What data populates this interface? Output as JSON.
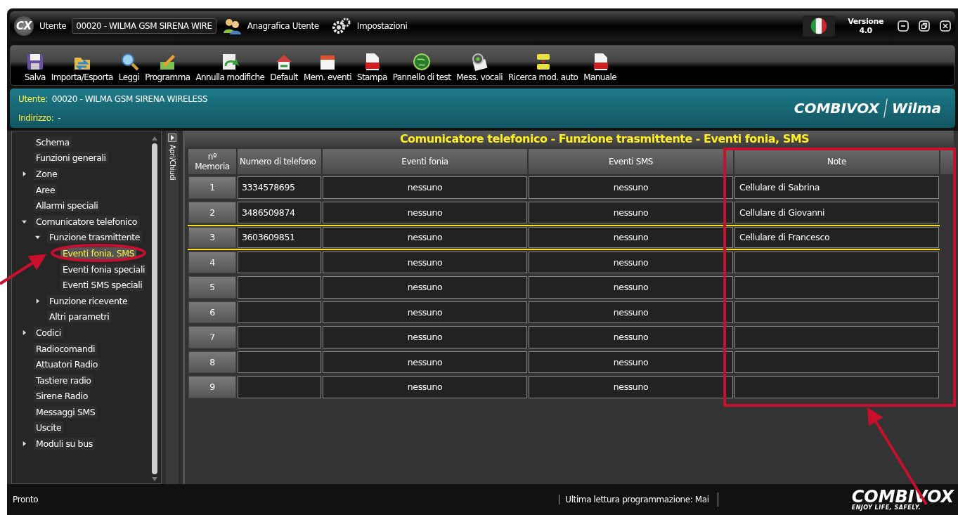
{
  "title_bar": {
    "logo": "CX",
    "utente_label": "Utente",
    "utente_value": "00020 - WILMA GSM SIRENA WIRE",
    "links": [
      {
        "kind": "users",
        "label": "Anagrafica Utente"
      },
      {
        "kind": "gears",
        "label": "Impostazioni"
      }
    ],
    "version_label": "Versione",
    "version_value": "4.0"
  },
  "toolbar": [
    {
      "kind": "floppy",
      "label": "Salva"
    },
    {
      "kind": "import",
      "label": "Importa/Esporta"
    },
    {
      "kind": "magnifier",
      "label": "Leggi"
    },
    {
      "kind": "pencil",
      "label": "Programma"
    },
    {
      "kind": "undo",
      "label": "Annulla modifiche"
    },
    {
      "kind": "house",
      "label": "Default"
    },
    {
      "kind": "calendar",
      "label": "Mem. eventi"
    },
    {
      "kind": "pdf",
      "label": "Stampa"
    },
    {
      "kind": "globe",
      "label": "Pannello di test"
    },
    {
      "kind": "headset",
      "label": "Mess. vocali"
    },
    {
      "kind": "plug",
      "label": "Ricerca mod. auto"
    },
    {
      "kind": "pdf",
      "label": "Manuale"
    }
  ],
  "header": {
    "utente_label": "Utente:",
    "utente_value": "00020  -  WILMA GSM SIRENA WIRELESS",
    "indirizzo_label": "Indirizzo:",
    "indirizzo_value": "-",
    "brand": "COMBIVOX",
    "brand_sub": "Wilma"
  },
  "sidebar": {
    "toggle": "Apri/Chiudi",
    "items": [
      {
        "kind": "leaf",
        "label": "Schema",
        "selected": false
      },
      {
        "kind": "leaf",
        "label": "Funzioni generali",
        "selected": false
      },
      {
        "kind": "folder",
        "label": "Zone",
        "expanded": false,
        "selected": false
      },
      {
        "kind": "leaf",
        "label": "Aree",
        "selected": false
      },
      {
        "kind": "leaf",
        "label": "Allarmi speciali",
        "selected": false
      },
      {
        "kind": "folder",
        "label": "Comunicatore telefonico",
        "expanded": true,
        "selected": false,
        "children": [
          {
            "kind": "folder",
            "label": "Funzione trasmittente",
            "expanded": true,
            "selected": false,
            "children": [
              {
                "kind": "leaf",
                "label": "Eventi fonia, SMS",
                "selected": true
              },
              {
                "kind": "leaf",
                "label": "Eventi fonia speciali",
                "selected": false
              },
              {
                "kind": "leaf",
                "label": "Eventi SMS speciali",
                "selected": false
              }
            ]
          },
          {
            "kind": "folder",
            "label": "Funzione ricevente",
            "expanded": false,
            "selected": false
          },
          {
            "kind": "leaf",
            "label": "Altri parametri",
            "selected": false
          }
        ]
      },
      {
        "kind": "folder",
        "label": "Codici",
        "expanded": false,
        "selected": false
      },
      {
        "kind": "leaf",
        "label": "Radiocomandi",
        "selected": false
      },
      {
        "kind": "leaf",
        "label": "Attuatori Radio",
        "selected": false
      },
      {
        "kind": "leaf",
        "label": "Tastiere radio",
        "selected": false
      },
      {
        "kind": "leaf",
        "label": "Sirene Radio",
        "selected": false
      },
      {
        "kind": "leaf",
        "label": "Messaggi SMS",
        "selected": false
      },
      {
        "kind": "leaf",
        "label": "Uscite",
        "selected": false
      },
      {
        "kind": "folder",
        "label": "Moduli su bus",
        "expanded": false,
        "selected": false
      }
    ]
  },
  "panel_title": "Comunicatore telefonico - Funzione trasmittente  - Eventi fonia, SMS",
  "table": {
    "columns": [
      "nº Memoria",
      "Numero di telefono",
      "Eventi fonia",
      "Eventi SMS",
      "Note"
    ],
    "rows": [
      {
        "memoria": "1",
        "telefono": "3334578695",
        "fonia": "nessuno",
        "sms": "nessuno",
        "note": "Cellulare di Sabrina",
        "selected": false
      },
      {
        "memoria": "2",
        "telefono": "3486509874",
        "fonia": "nessuno",
        "sms": "nessuno",
        "note": "Cellulare di Giovanni",
        "selected": false
      },
      {
        "memoria": "3",
        "telefono": "3603609851",
        "fonia": "nessuno",
        "sms": "nessuno",
        "note": "Cellulare di Francesco",
        "selected": true
      },
      {
        "memoria": "4",
        "fonia": "nessuno",
        "sms": "nessuno",
        "selected": false
      },
      {
        "memoria": "5",
        "fonia": "nessuno",
        "sms": "nessuno",
        "selected": false
      },
      {
        "memoria": "6",
        "fonia": "nessuno",
        "sms": "nessuno",
        "selected": false
      },
      {
        "memoria": "7",
        "fonia": "nessuno",
        "sms": "nessuno",
        "selected": false
      },
      {
        "memoria": "8",
        "fonia": "nessuno",
        "sms": "nessuno",
        "selected": false
      },
      {
        "memoria": "9",
        "fonia": "nessuno",
        "sms": "nessuno",
        "selected": false
      }
    ]
  },
  "status_bar": {
    "status": "Pronto",
    "last_read": "Ultima lettura programmazione: Mai"
  },
  "footer_logo": {
    "brand": "COMBIVOX",
    "tagline": "ENJOY LIFE, SAFELY."
  }
}
